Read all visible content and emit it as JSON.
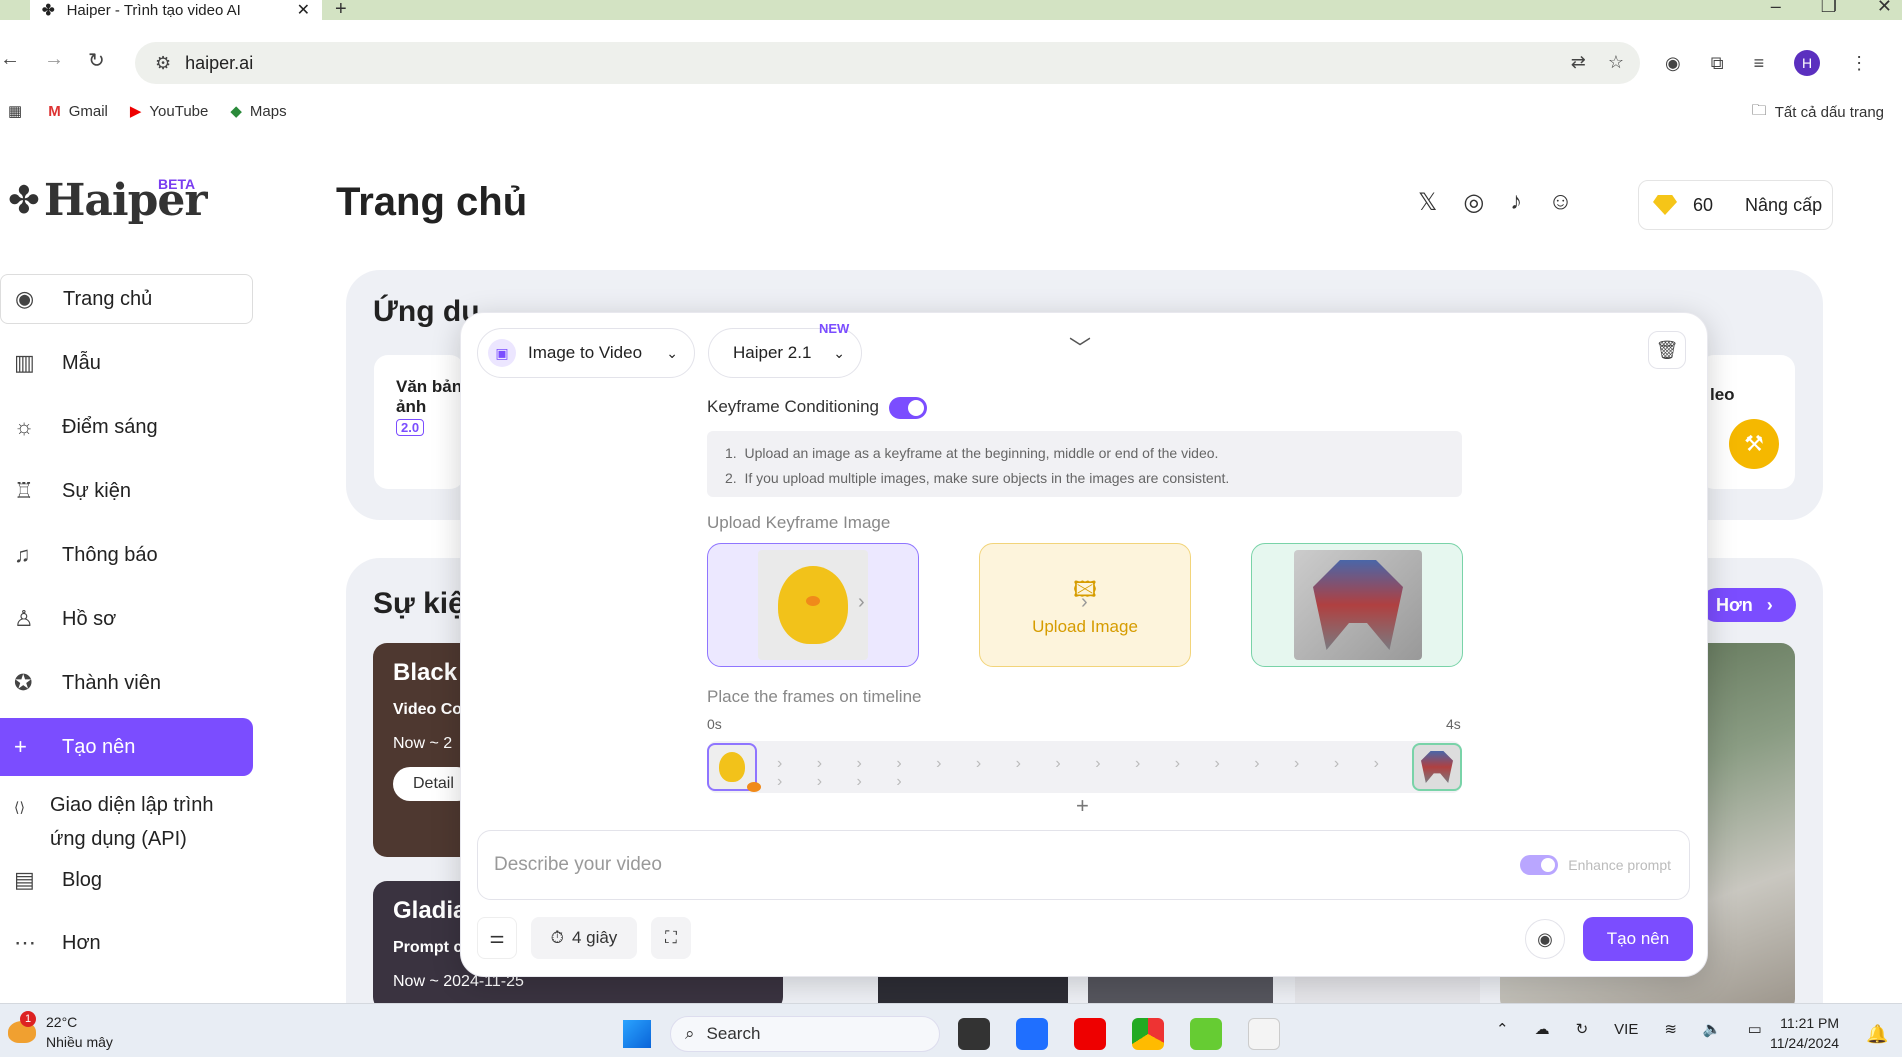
{
  "browser": {
    "tab_title": "Haiper - Trình tạo video AI",
    "url": "haiper.ai",
    "bookmarks": [
      "Gmail",
      "YouTube",
      "Maps"
    ],
    "all_bookmarks": "Tất cả dấu trang",
    "profile_initial": "H"
  },
  "header": {
    "logo": "Haiper",
    "beta": "BETA",
    "title": "Trang chủ",
    "credits": "60",
    "upgrade": "Nâng cấp"
  },
  "sidebar": {
    "items": [
      {
        "label": "Trang chủ",
        "icon": "compass-icon"
      },
      {
        "label": "Mẫu",
        "icon": "templates-icon"
      },
      {
        "label": "Điểm sáng",
        "icon": "lightbulb-icon"
      },
      {
        "label": "Sự kiện",
        "icon": "trophy-icon"
      },
      {
        "label": "Thông báo",
        "icon": "bell-icon"
      },
      {
        "label": "Hồ sơ",
        "icon": "user-icon"
      },
      {
        "label": "Thành viên",
        "icon": "badge-icon"
      },
      {
        "label": "Tạo nên",
        "icon": "plus-icon"
      },
      {
        "label": "Giao diện lập trình ứng dụng (API)",
        "icon": "api-icon"
      },
      {
        "label": "Blog",
        "icon": "blog-icon"
      },
      {
        "label": "Hơn",
        "icon": "more-icon"
      }
    ]
  },
  "apps": {
    "title": "Ứng dụ",
    "card_left_title": "Văn bản\nảnh",
    "card_left_version": "2.0",
    "card_right_title": "leo"
  },
  "events": {
    "title": "Sự kiện",
    "more": "Hơn",
    "cards": [
      {
        "title": "Black",
        "subtitle": "Video Co",
        "date": "Now ~ 2",
        "button": "Detail"
      },
      {
        "title": "Gladia",
        "subtitle": "Prompt c",
        "date": "Now ~ 2024-11-25"
      }
    ]
  },
  "modal": {
    "mode": "Image to Video",
    "model": "Haiper 2.1",
    "new_badge": "NEW",
    "keyframe_label": "Keyframe Conditioning",
    "keyframe_enabled": true,
    "instructions": [
      "Upload an image as a keyframe at the beginning, middle or end of the video.",
      "If you upload multiple images, make sure objects in the images are consistent."
    ],
    "upload_label": "Upload Keyframe Image",
    "upload_button": "Upload Image",
    "timeline_label": "Place the frames on timeline",
    "timeline_start": "0s",
    "timeline_end": "4s",
    "prompt_placeholder": "Describe your video",
    "enhance_prompt": "Enhance prompt",
    "duration": "4 giây",
    "create": "Tạo nên"
  },
  "taskbar": {
    "temp": "22°C",
    "weather": "Nhiều mây",
    "weather_badge": "1",
    "search": "Search",
    "lang": "VIE",
    "time": "11:21 PM",
    "date": "11/24/2024"
  }
}
